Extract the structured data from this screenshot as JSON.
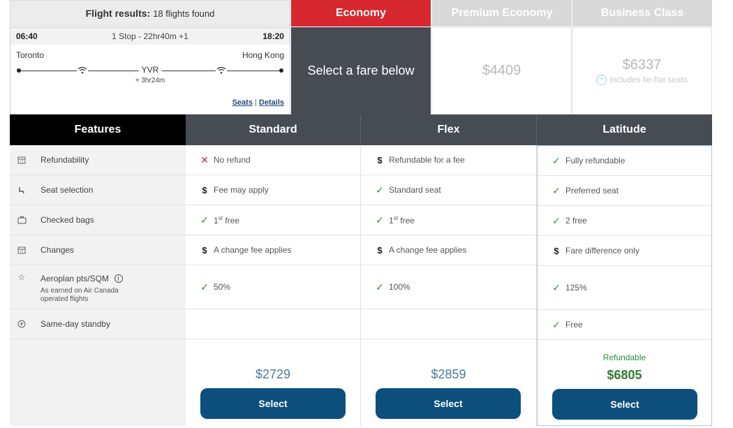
{
  "header": {
    "results_label": "Flight results:",
    "results_count": "18 flights found"
  },
  "tabs": [
    {
      "label": "Economy",
      "active": true
    },
    {
      "label": "Premium Economy",
      "active": false
    },
    {
      "label": "Business Class",
      "active": false
    }
  ],
  "flight": {
    "depart_time": "06:40",
    "stops": "1 Stop - 22hr40m +1",
    "arrive_time": "18:20",
    "origin": "Toronto",
    "destination": "Hong Kong",
    "stop_code": "YVR",
    "layover": "+ 3hr24m",
    "seats_link": "Seats",
    "details_link": "Details",
    "separator": "|"
  },
  "economy_prompt": "Select a fare below",
  "premium_price": "$4409",
  "business_price": "$6337",
  "business_note": "Includes lie-flat seats",
  "columns": {
    "features": "Features",
    "standard": "Standard",
    "flex": "Flex",
    "latitude": "Latitude"
  },
  "features": [
    {
      "icon": "calendar-icon",
      "label": "Refundability"
    },
    {
      "icon": "seat-icon",
      "label": "Seat selection"
    },
    {
      "icon": "bag-icon",
      "label": "Checked bags"
    },
    {
      "icon": "calendar-icon",
      "label": "Changes"
    },
    {
      "icon": "star-icon",
      "label": "Aeroplan pts/SQM",
      "info_icon": "i",
      "sub": "As earned on Air Canada operated flights"
    },
    {
      "icon": "standby-icon",
      "label": "Same-day standby"
    }
  ],
  "standard": {
    "refund": "No refund",
    "seat": "Fee may apply",
    "bags_num": "1",
    "bags_sup": "st",
    "bags_rest": " free",
    "changes": "A change fee applies",
    "points": "50%",
    "standby": "",
    "price": "$2729",
    "select": "Select"
  },
  "flex": {
    "refund": "Refundable for a fee",
    "seat": "Standard seat",
    "bags_num": "1",
    "bags_sup": "st",
    "bags_rest": " free",
    "changes": "A change fee applies",
    "points": "100%",
    "standby": "",
    "price": "$2859",
    "select": "Select"
  },
  "latitude": {
    "refund": "Fully refundable",
    "seat": "Preferred seat",
    "bags": "2 free",
    "changes": "Fare difference only",
    "points": "125%",
    "standby": "Free",
    "refund_note": "Refundable",
    "price": "$6805",
    "select": "Select"
  },
  "marks": {
    "yes": "✓",
    "no": "✕",
    "fee": "$"
  },
  "colors": {
    "economy_tab": "#d8282f",
    "select_button": "#0d4f7c",
    "included": "#2e8b3a"
  }
}
